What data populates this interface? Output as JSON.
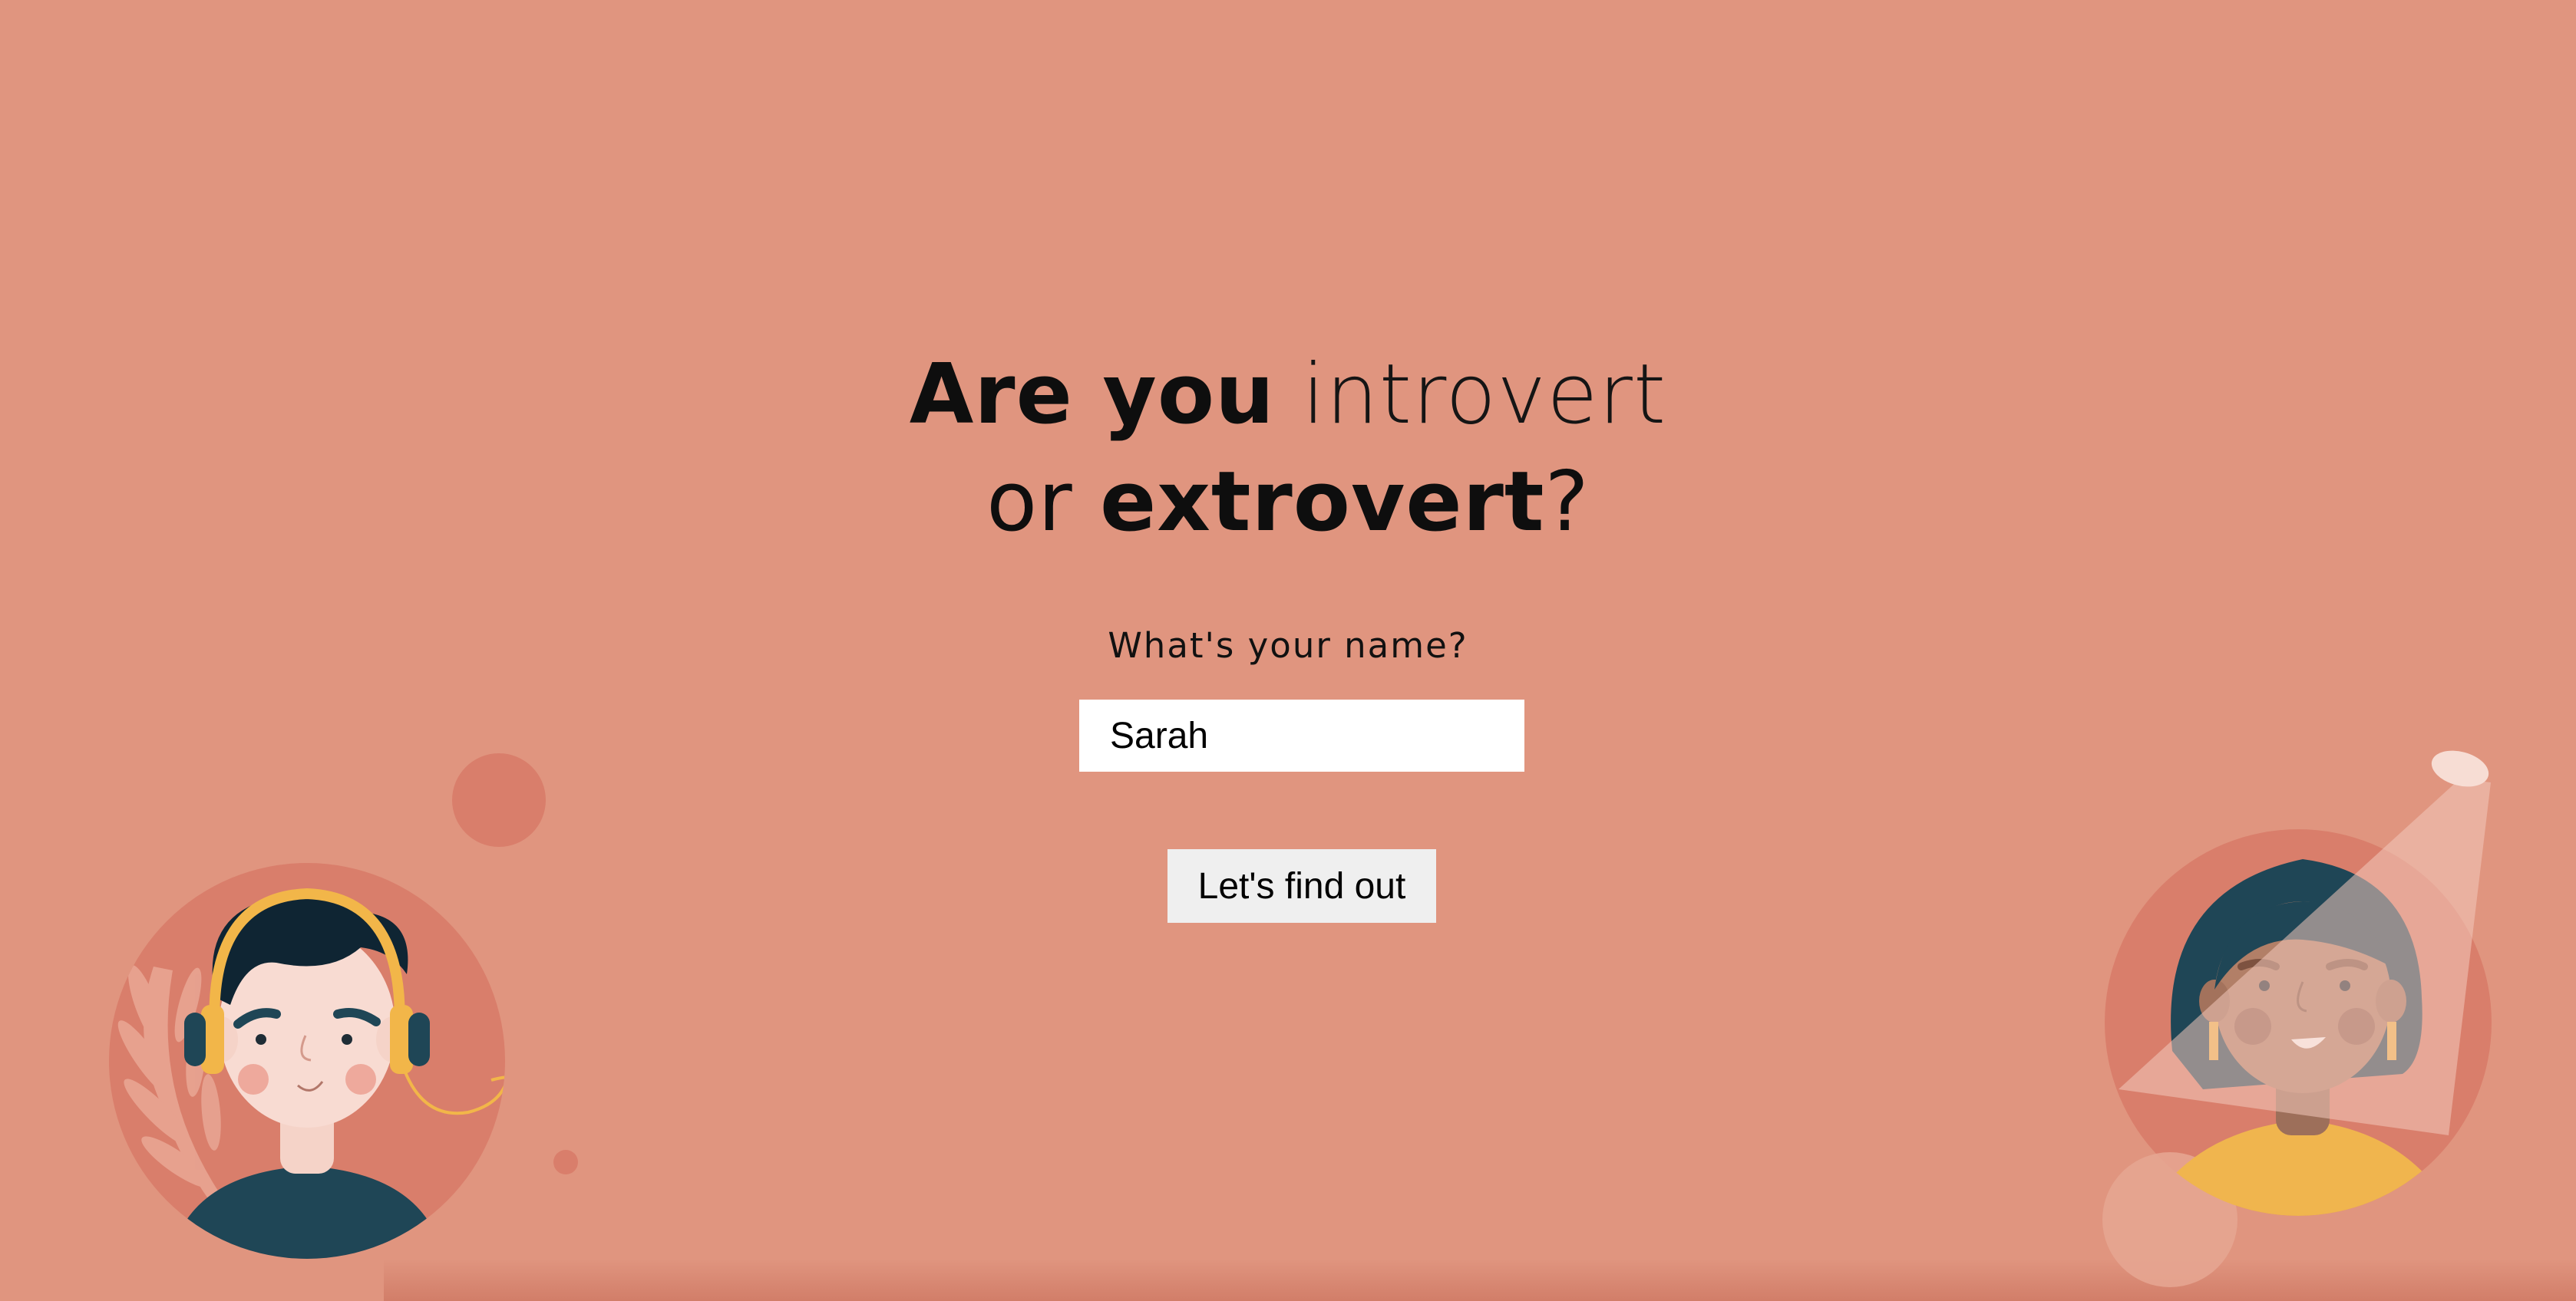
{
  "heading": {
    "line1_bold": "Are you",
    "line1_light": "introvert",
    "line2_normal": "or",
    "line2_bold": "extrovert",
    "line2_mark": "?"
  },
  "form": {
    "question": "What's your name?",
    "name_value": "Sarah",
    "submit_label": "Let's find out"
  },
  "illustrations": {
    "left_icon": "introvert-avatar-with-headphones-icon",
    "right_icon": "extrovert-avatar-in-spotlight-icon"
  },
  "colors": {
    "background": "#e0957f",
    "circle": "#d97e6b",
    "hair": "#1f4656",
    "headphones": "#f2b649",
    "shirt_left": "#1f4656",
    "shirt_right": "#f0b54e"
  }
}
